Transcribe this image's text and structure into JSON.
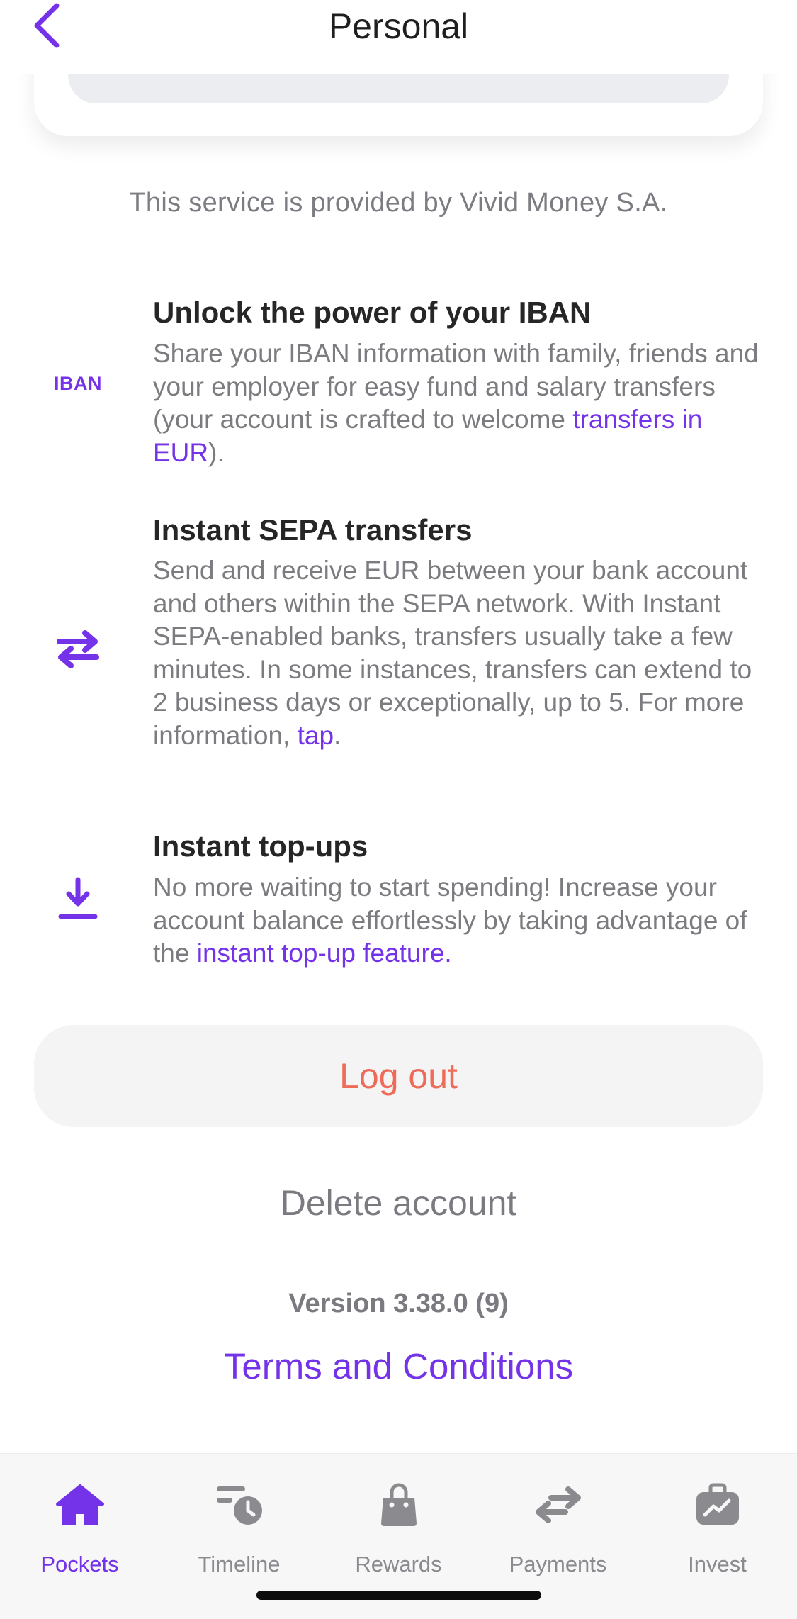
{
  "header": {
    "title": "Personal",
    "back_icon": "chevron-left-icon"
  },
  "provider_note": "This service is provided by Vivid Money S.A.",
  "features": [
    {
      "icon": "iban-icon",
      "icon_text": "IBAN",
      "title": "Unlock the power of your IBAN",
      "text_before": "Share your IBAN information with family, friends and your employer for easy fund and salary transfers (your account is crafted to welcome ",
      "link": "transfers in EUR",
      "text_after": ")."
    },
    {
      "icon": "transfer-arrows-icon",
      "title": "Instant SEPA transfers",
      "text_before": "Send and receive EUR between your bank account and others within the SEPA network. With Instant SEPA-enabled banks, transfers usually take a few minutes. In some instances, transfers can extend to 2 business days or exceptionally, up to 5. For more information, ",
      "link": "tap",
      "text_after": "."
    },
    {
      "icon": "download-icon",
      "title": "Instant top-ups",
      "text_before": "No more waiting to start spending! Increase your account balance effortlessly by taking advantage of the ",
      "link": "instant top-up feature.",
      "text_after": ""
    }
  ],
  "actions": {
    "logout": "Log out",
    "delete": "Delete account",
    "version": "Version 3.38.0 (9)",
    "terms": "Terms and Conditions"
  },
  "tabbar": {
    "active": "Pockets",
    "tabs": [
      {
        "label": "Pockets",
        "icon": "home-icon"
      },
      {
        "label": "Timeline",
        "icon": "timeline-icon"
      },
      {
        "label": "Rewards",
        "icon": "shopping-bag-icon"
      },
      {
        "label": "Payments",
        "icon": "transfer-arrows-icon"
      },
      {
        "label": "Invest",
        "icon": "briefcase-chart-icon"
      }
    ]
  },
  "colors": {
    "accent": "#7433e8",
    "logout": "#ef6b59",
    "muted_text": "#7b7b80",
    "tab_inactive": "#8a8a8f"
  }
}
